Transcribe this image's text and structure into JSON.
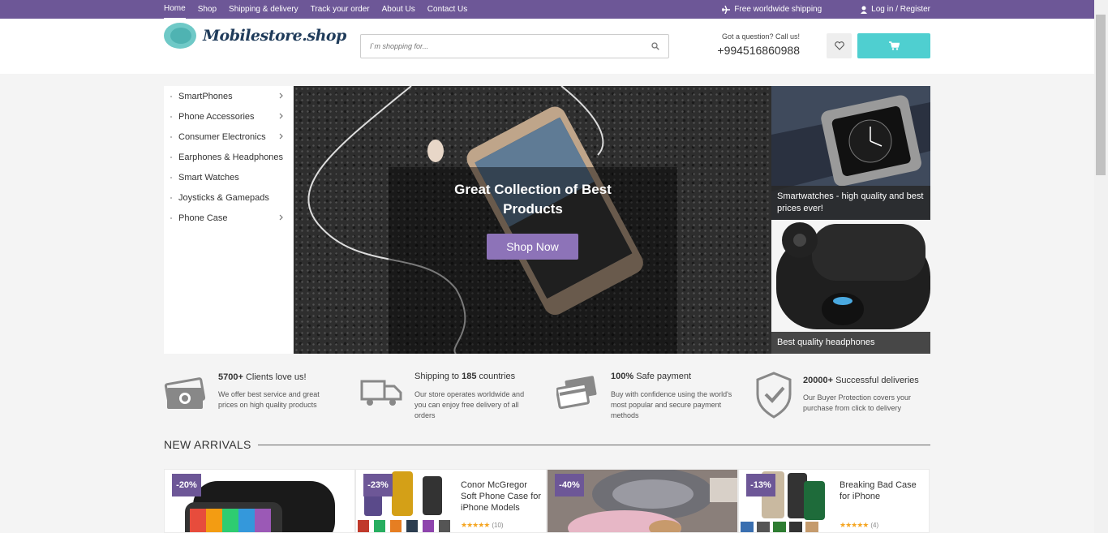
{
  "topnav": {
    "links": [
      "Home",
      "Shop",
      "Shipping & delivery",
      "Track your order",
      "About Us",
      "Contact Us"
    ],
    "shipping": "Free worldwide shipping",
    "login": "Log in / Register"
  },
  "header": {
    "logo": "Mobilestore.shop",
    "search_placeholder": "I`m shopping for...",
    "call_question": "Got a question? Call us!",
    "phone": "+994516860988"
  },
  "sidebar": {
    "items": [
      {
        "label": "SmartPhones",
        "arrow": true
      },
      {
        "label": "Phone Accessories",
        "arrow": true
      },
      {
        "label": "Consumer Electronics",
        "arrow": true
      },
      {
        "label": "Earphones & Headphones",
        "arrow": false
      },
      {
        "label": "Smart Watches",
        "arrow": false
      },
      {
        "label": "Joysticks & Gamepads",
        "arrow": false
      },
      {
        "label": "Phone Case",
        "arrow": true
      }
    ]
  },
  "hero": {
    "title": "Great Collection of Best Products",
    "button": "Shop Now"
  },
  "promos": [
    {
      "caption": "Smartwatches - high quality and best prices ever!"
    },
    {
      "caption": "Best quality headphones"
    }
  ],
  "features": [
    {
      "title_bold": "5700+",
      "title_rest": " Clients love us!",
      "desc": "We offer best service and great prices on high quality products"
    },
    {
      "title_pre": "Shipping to ",
      "title_bold": "185",
      "title_rest": " countries",
      "desc": "Our store operates worldwide and you can enjoy free delivery of all orders"
    },
    {
      "title_bold": "100%",
      "title_rest": " Safe payment",
      "desc": "Buy with confidence using the world's most popular and secure payment methods"
    },
    {
      "title_bold": "20000+",
      "title_rest": " Successful deliveries",
      "desc": "Our Buyer Protection covers your purchase from click to delivery"
    }
  ],
  "new_arrivals": {
    "title": "NEW ARRIVALS",
    "products": [
      {
        "badge": "-20%",
        "name": "",
        "count": ""
      },
      {
        "badge": "-23%",
        "name": "Conor McGregor Soft Phone Case for iPhone Models",
        "stars": "★★★★★",
        "count": "(10)"
      },
      {
        "badge": "-40%",
        "name": "",
        "count": ""
      },
      {
        "badge": "-13%",
        "name": "Breaking Bad Case for iPhone",
        "stars": "★★★★★",
        "count": "(4)"
      }
    ]
  },
  "colors": {
    "brand_purple": "#6d5797",
    "button_purple": "#8d73b8",
    "cart_teal": "#4fcfd0"
  }
}
